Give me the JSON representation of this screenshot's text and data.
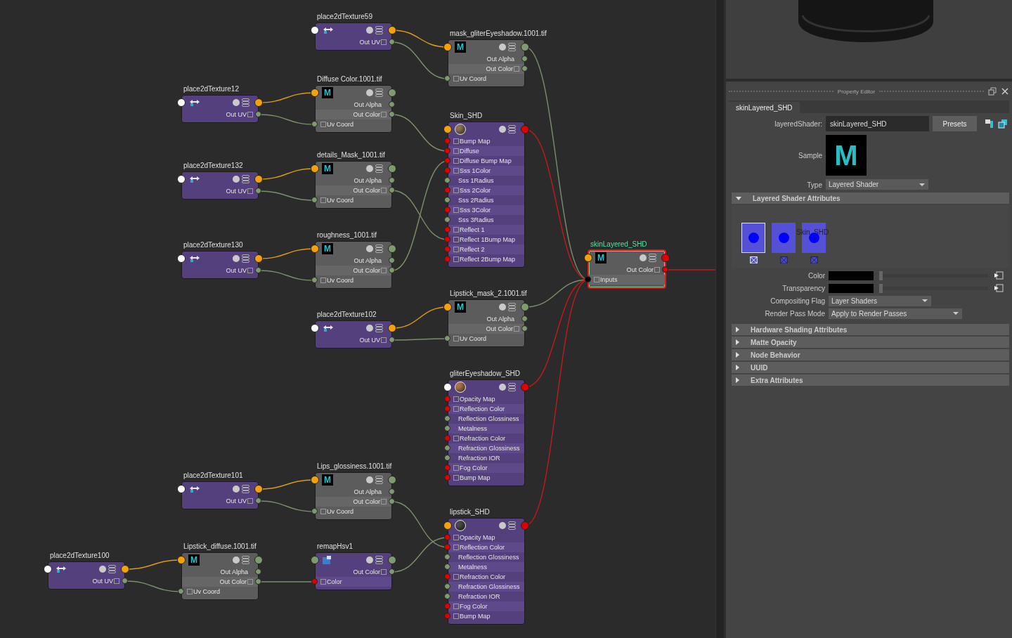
{
  "node_editor": {
    "nodes": [
      {
        "title": "place2dTexture59",
        "kind": "place2d",
        "selected": false,
        "ports": [
          {
            "kind": "in",
            "color": "#ffffff"
          },
          {
            "kind": "out",
            "color": "#f5a20a"
          }
        ],
        "rows": [
          {
            "label": "Out UV",
            "kind": "out",
            "compound": true,
            "color": "#7f9a6e"
          }
        ]
      },
      {
        "title": "mask_gliterEyeshadow.1001.tif",
        "kind": "file",
        "badge": "M",
        "selected": false,
        "ports": [
          {
            "kind": "in",
            "color": "#f5a20a"
          },
          {
            "kind": "out",
            "color": "#7f9a6e"
          }
        ],
        "rows": [
          {
            "label": "Out Alpha",
            "kind": "out",
            "compound": false,
            "color": "#7f9a6e"
          },
          {
            "label": "Out Color",
            "kind": "out",
            "compound": true,
            "color": "#7f9a6e"
          },
          {
            "label": "Uv Coord",
            "kind": "in",
            "compound": true,
            "color": "#7f9a6e"
          }
        ]
      },
      {
        "title": "place2dTexture12",
        "kind": "place2d",
        "selected": false,
        "ports": [
          {
            "kind": "in",
            "color": "#ffffff"
          },
          {
            "kind": "out",
            "color": "#f5a20a"
          }
        ],
        "rows": [
          {
            "label": "Out UV",
            "kind": "out",
            "compound": true,
            "color": "#7f9a6e"
          }
        ]
      },
      {
        "title": "Diffuse Color.1001.tif",
        "kind": "file",
        "badge": "M",
        "selected": false,
        "ports": [
          {
            "kind": "in",
            "color": "#f5a20a"
          },
          {
            "kind": "out",
            "color": "#7f9a6e"
          }
        ],
        "rows": [
          {
            "label": "Out Alpha",
            "kind": "out",
            "compound": false,
            "color": "#7f9a6e"
          },
          {
            "label": "Out Color",
            "kind": "out",
            "compound": true,
            "color": "#7f9a6e"
          },
          {
            "label": "Uv Coord",
            "kind": "in",
            "compound": true,
            "color": "#7f9a6e"
          }
        ]
      },
      {
        "title": "Skin_SHD",
        "kind": "shader",
        "swatch": {
          "color": "#8a7358"
        },
        "selected": false,
        "ports": [
          {
            "kind": "in",
            "color": "#f5a20a"
          },
          {
            "kind": "out",
            "color": "#e00000"
          }
        ],
        "rows": [
          {
            "label": "Bump Map",
            "kind": "in",
            "compound": true,
            "color": "#e00000"
          },
          {
            "label": "Diffuse",
            "kind": "in",
            "compound": true,
            "color": "#e00000"
          },
          {
            "label": "Diffuse Bump Map",
            "kind": "in",
            "compound": true,
            "color": "#e00000"
          },
          {
            "label": "Sss 1Color",
            "kind": "in",
            "compound": true,
            "color": "#e00000"
          },
          {
            "label": "Sss 1Radius",
            "kind": "in",
            "compound": false,
            "color": "#7f9a6e"
          },
          {
            "label": "Sss 2Color",
            "kind": "in",
            "compound": true,
            "color": "#e00000"
          },
          {
            "label": "Sss 2Radius",
            "kind": "in",
            "compound": false,
            "color": "#7f9a6e"
          },
          {
            "label": "Sss 3Color",
            "kind": "in",
            "compound": true,
            "color": "#e00000"
          },
          {
            "label": "Sss 3Radius",
            "kind": "in",
            "compound": false,
            "color": "#7f9a6e"
          },
          {
            "label": "Reflect 1",
            "kind": "in",
            "compound": true,
            "color": "#e00000"
          },
          {
            "label": "Reflect 1Bump Map",
            "kind": "in",
            "compound": true,
            "color": "#e00000"
          },
          {
            "label": "Reflect 2",
            "kind": "in",
            "compound": true,
            "color": "#e00000"
          },
          {
            "label": "Reflect 2Bump Map",
            "kind": "in",
            "compound": true,
            "color": "#e00000"
          }
        ]
      },
      {
        "title": "place2dTexture132",
        "kind": "place2d",
        "selected": false,
        "ports": [
          {
            "kind": "in",
            "color": "#ffffff"
          },
          {
            "kind": "out",
            "color": "#f5a20a"
          }
        ],
        "rows": [
          {
            "label": "Out UV",
            "kind": "out",
            "compound": true,
            "color": "#7f9a6e"
          }
        ]
      },
      {
        "title": "details_Mask_1001.tif",
        "kind": "file",
        "badge": "M",
        "selected": false,
        "ports": [
          {
            "kind": "in",
            "color": "#f5a20a"
          },
          {
            "kind": "out",
            "color": "#7f9a6e"
          }
        ],
        "rows": [
          {
            "label": "Out Alpha",
            "kind": "out",
            "compound": false,
            "color": "#7f9a6e"
          },
          {
            "label": "Out Color",
            "kind": "out",
            "compound": true,
            "color": "#7f9a6e"
          },
          {
            "label": "Uv Coord",
            "kind": "in",
            "compound": true,
            "color": "#7f9a6e"
          }
        ]
      },
      {
        "title": "place2dTexture130",
        "kind": "place2d",
        "selected": false,
        "ports": [
          {
            "kind": "in",
            "color": "#ffffff"
          },
          {
            "kind": "out",
            "color": "#f5a20a"
          }
        ],
        "rows": [
          {
            "label": "Out UV",
            "kind": "out",
            "compound": true,
            "color": "#7f9a6e"
          }
        ]
      },
      {
        "title": "roughness_1001.tif",
        "kind": "file",
        "badge": "M",
        "selected": false,
        "ports": [
          {
            "kind": "in",
            "color": "#f5a20a"
          },
          {
            "kind": "out",
            "color": "#7f9a6e"
          }
        ],
        "rows": [
          {
            "label": "Out Alpha",
            "kind": "out",
            "compound": false,
            "color": "#7f9a6e"
          },
          {
            "label": "Out Color",
            "kind": "out",
            "compound": true,
            "color": "#7f9a6e"
          },
          {
            "label": "Uv Coord",
            "kind": "in",
            "compound": true,
            "color": "#7f9a6e"
          }
        ]
      },
      {
        "title": "skinLayered_SHD",
        "kind": "layered",
        "badge": "M",
        "selected": true,
        "ports": [
          {
            "kind": "in",
            "color": "#f5a20a"
          },
          {
            "kind": "out",
            "color": "#e00000"
          }
        ],
        "rows": [
          {
            "label": "Out Color",
            "kind": "out",
            "compound": true,
            "color": "#e00000"
          },
          {
            "label": "Inputs",
            "kind": "in",
            "compound": true,
            "color": "#000000"
          }
        ]
      },
      {
        "title": "place2dTexture102",
        "kind": "place2d",
        "selected": false,
        "ports": [
          {
            "kind": "in",
            "color": "#ffffff"
          },
          {
            "kind": "out",
            "color": "#f5a20a"
          }
        ],
        "rows": [
          {
            "label": "Out UV",
            "kind": "out",
            "compound": true,
            "color": "#7f9a6e"
          }
        ]
      },
      {
        "title": "Lipstick_mask_2.1001.tif",
        "kind": "file",
        "badge": "M",
        "selected": false,
        "ports": [
          {
            "kind": "in",
            "color": "#f5a20a"
          },
          {
            "kind": "out",
            "color": "#7f9a6e"
          }
        ],
        "rows": [
          {
            "label": "Out Alpha",
            "kind": "out",
            "compound": false,
            "color": "#7f9a6e"
          },
          {
            "label": "Out Color",
            "kind": "out",
            "compound": true,
            "color": "#7f9a6e"
          },
          {
            "label": "Uv Coord",
            "kind": "in",
            "compound": true,
            "color": "#7f9a6e"
          }
        ]
      },
      {
        "title": "gliterEyeshadow_SHD",
        "kind": "shader",
        "swatch": {
          "color": "#a8754a"
        },
        "selected": false,
        "ports": [
          {
            "kind": "in",
            "color": "#ffffff"
          },
          {
            "kind": "out",
            "color": "#e00000"
          }
        ],
        "rows": [
          {
            "label": "Opacity Map",
            "kind": "in",
            "compound": true,
            "color": "#e00000"
          },
          {
            "label": "Reflection Color",
            "kind": "in",
            "compound": true,
            "color": "#e00000"
          },
          {
            "label": "Reflection Glossiness",
            "kind": "in",
            "compound": false,
            "color": "#7f9a6e"
          },
          {
            "label": "Metalness",
            "kind": "in",
            "compound": false,
            "color": "#7f9a6e"
          },
          {
            "label": "Refraction Color",
            "kind": "in",
            "compound": true,
            "color": "#e00000"
          },
          {
            "label": "Refraction Glossiness",
            "kind": "in",
            "compound": false,
            "color": "#7f9a6e"
          },
          {
            "label": "Refraction IOR",
            "kind": "in",
            "compound": false,
            "color": "#7f9a6e"
          },
          {
            "label": "Fog Color",
            "kind": "in",
            "compound": true,
            "color": "#e00000"
          },
          {
            "label": "Bump Map",
            "kind": "in",
            "compound": true,
            "color": "#e00000"
          }
        ]
      },
      {
        "title": "place2dTexture101",
        "kind": "place2d",
        "selected": false,
        "ports": [
          {
            "kind": "in",
            "color": "#ffffff"
          },
          {
            "kind": "out",
            "color": "#f5a20a"
          }
        ],
        "rows": [
          {
            "label": "Out UV",
            "kind": "out",
            "compound": true,
            "color": "#7f9a6e"
          }
        ]
      },
      {
        "title": "Lips_glossiness.1001.tif",
        "kind": "file",
        "badge": "M",
        "selected": false,
        "ports": [
          {
            "kind": "in",
            "color": "#f5a20a"
          },
          {
            "kind": "out",
            "color": "#7f9a6e"
          }
        ],
        "rows": [
          {
            "label": "Out Alpha",
            "kind": "out",
            "compound": false,
            "color": "#7f9a6e"
          },
          {
            "label": "Out Color",
            "kind": "out",
            "compound": true,
            "color": "#7f9a6e"
          },
          {
            "label": "Uv Coord",
            "kind": "in",
            "compound": true,
            "color": "#7f9a6e"
          }
        ]
      },
      {
        "title": "lipstick_SHD",
        "kind": "shader",
        "swatch": {
          "color": "#4a4a4a"
        },
        "selected": false,
        "ports": [
          {
            "kind": "in",
            "color": "#f5a20a"
          },
          {
            "kind": "out",
            "color": "#e00000"
          }
        ],
        "rows": [
          {
            "label": "Opacity Map",
            "kind": "in",
            "compound": true,
            "color": "#e00000"
          },
          {
            "label": "Reflection Color",
            "kind": "in",
            "compound": true,
            "color": "#e00000"
          },
          {
            "label": "Reflection Glossiness",
            "kind": "in",
            "compound": false,
            "color": "#7f9a6e"
          },
          {
            "label": "Metalness",
            "kind": "in",
            "compound": false,
            "color": "#7f9a6e"
          },
          {
            "label": "Refraction Color",
            "kind": "in",
            "compound": true,
            "color": "#e00000"
          },
          {
            "label": "Refraction Glossiness",
            "kind": "in",
            "compound": false,
            "color": "#7f9a6e"
          },
          {
            "label": "Refraction IOR",
            "kind": "in",
            "compound": false,
            "color": "#7f9a6e"
          },
          {
            "label": "Fog Color",
            "kind": "in",
            "compound": true,
            "color": "#e00000"
          },
          {
            "label": "Bump Map",
            "kind": "in",
            "compound": true,
            "color": "#e00000"
          }
        ]
      },
      {
        "title": "place2dTexture100",
        "kind": "place2d",
        "selected": false,
        "ports": [
          {
            "kind": "in",
            "color": "#ffffff"
          },
          {
            "kind": "out",
            "color": "#f5a20a"
          }
        ],
        "rows": [
          {
            "label": "Out UV",
            "kind": "out",
            "compound": true,
            "color": "#7f9a6e"
          }
        ]
      },
      {
        "title": "Lipstick_diffuse.1001.tif",
        "kind": "file",
        "badge": "M",
        "selected": false,
        "ports": [
          {
            "kind": "in",
            "color": "#f5a20a"
          },
          {
            "kind": "out",
            "color": "#7f9a6e"
          }
        ],
        "rows": [
          {
            "label": "Out Alpha",
            "kind": "out",
            "compound": false,
            "color": "#7f9a6e"
          },
          {
            "label": "Out Color",
            "kind": "out",
            "compound": true,
            "color": "#7f9a6e"
          },
          {
            "label": "Uv Coord",
            "kind": "in",
            "compound": true,
            "color": "#7f9a6e"
          }
        ]
      },
      {
        "title": "remapHsv1",
        "kind": "remap",
        "selected": false,
        "ports": [
          {
            "kind": "in",
            "color": "#7f9a6e"
          },
          {
            "kind": "out",
            "color": "#7f9a6e"
          }
        ],
        "rows": [
          {
            "label": "Out Color",
            "kind": "out",
            "compound": true,
            "color": "#7f9a6e"
          },
          {
            "label": "Color",
            "kind": "in",
            "compound": true,
            "color": "#e00000"
          }
        ]
      }
    ]
  },
  "property_editor": {
    "title": "Property Editor",
    "tab": "skinLayered_SHD",
    "name_field": {
      "label": "layeredShader:",
      "value": "skinLayered_SHD"
    },
    "presets_button": "Presets",
    "sample": {
      "label": "Sample",
      "badge": "M"
    },
    "type": {
      "label": "Type",
      "value": "Layered Shader"
    },
    "sections": [
      {
        "title": "Layered Shader Attributes",
        "expanded": true
      },
      {
        "title": "Hardware Shading Attributes",
        "expanded": false
      },
      {
        "title": "Matte Opacity",
        "expanded": false
      },
      {
        "title": "Node Behavior",
        "expanded": false
      },
      {
        "title": "UUID",
        "expanded": false
      },
      {
        "title": "Extra Attributes",
        "expanded": false
      }
    ],
    "layers": [
      {
        "selected": true
      },
      {
        "selected": false
      },
      {
        "selected": false
      }
    ],
    "layer_label": "Skin_SHD",
    "attributes": [
      {
        "label": "Color",
        "kind": "color",
        "color": "#000000",
        "level": 0
      },
      {
        "label": "Transparency",
        "kind": "color",
        "color": "#000000",
        "level": 0
      },
      {
        "label": "Compositing Flag",
        "kind": "dropdown",
        "value": "Layer Shaders"
      },
      {
        "label": "Render Pass Mode",
        "kind": "dropdown",
        "value": "Apply to Render Passes"
      }
    ]
  }
}
